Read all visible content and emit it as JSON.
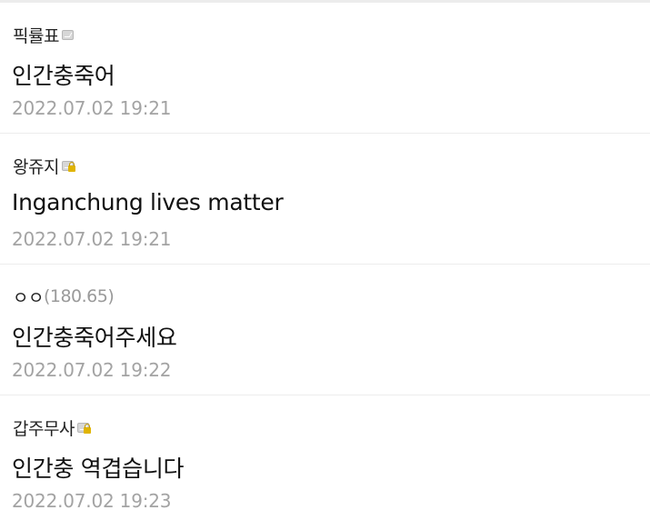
{
  "comments": [
    {
      "author": "픽률표",
      "ip": "",
      "badge_icon": "gall-member-icon",
      "text": "인간충죽어",
      "timestamp": "2022.07.02 19:21"
    },
    {
      "author": "왕쥬지",
      "ip": "",
      "badge_icon": "gall-member-lock-icon",
      "text": "Inganchung lives matter",
      "timestamp": "2022.07.02 19:21"
    },
    {
      "author": "ㅇㅇ",
      "ip": "(180.65)",
      "badge_icon": "",
      "text": "인간충죽어주세요",
      "timestamp": "2022.07.02 19:22"
    },
    {
      "author": "갑주무사",
      "ip": "",
      "badge_icon": "gall-member-lock-icon",
      "text": "인간충 역겹습니다",
      "timestamp": "2022.07.02 19:23"
    }
  ]
}
